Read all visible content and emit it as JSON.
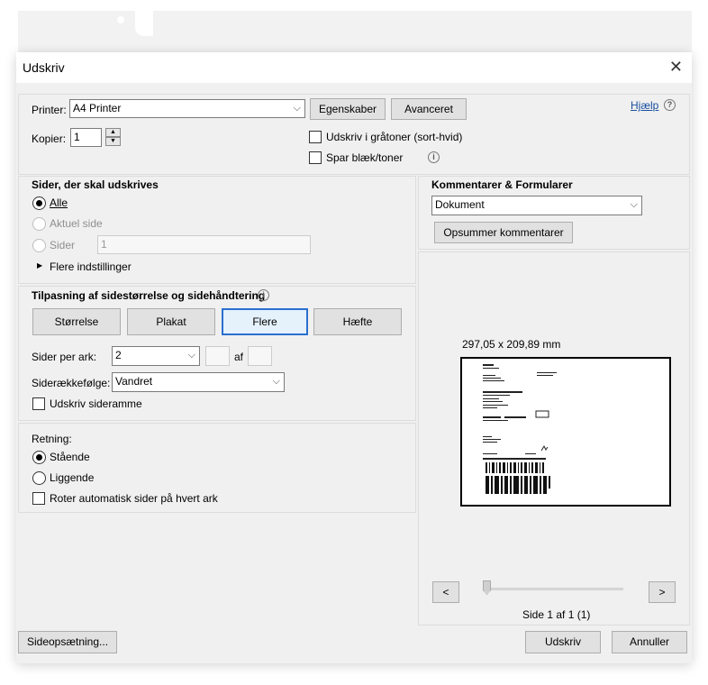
{
  "dialog": {
    "title": "Udskriv"
  },
  "printer": {
    "printer_label": "Printer:",
    "printer_value": "A4 Printer",
    "properties_button": "Egenskaber",
    "advanced_button": "Avanceret",
    "help_link": "Hjælp",
    "copies_label": "Kopier:",
    "copies_value": "1",
    "grayscale_label": "Udskriv i gråtoner (sort-hvid)",
    "grayscale_checked": false,
    "save_ink_label": "Spar blæk/toner",
    "save_ink_checked": false
  },
  "pages": {
    "heading": "Sider, der skal udskrives",
    "all_label": "Alle",
    "current_label": "Aktuel side",
    "pages_label": "Sider",
    "pages_value": "1",
    "more_options": "Flere indstillinger",
    "selected": "Alle"
  },
  "comments": {
    "heading": "Kommentarer & Formularer",
    "dropdown_value": "Dokument",
    "summarize_button": "Opsummer kommentarer"
  },
  "sizing": {
    "heading": "Tilpasning af sidestørrelse og sidehåndtering",
    "tabs": [
      "Størrelse",
      "Plakat",
      "Flere",
      "Hæfte"
    ],
    "active_tab": "Flere",
    "pages_per_sheet_label": "Sider per ark:",
    "pages_per_sheet_value": "2",
    "of_label": "af",
    "page_order_label": "Siderækkefølge:",
    "page_order_value": "Vandret",
    "print_border_label": "Udskriv sideramme",
    "print_border_checked": false
  },
  "orientation": {
    "heading": "Retning:",
    "portrait_label": "Stående",
    "landscape_label": "Liggende",
    "auto_rotate_label": "Roter automatisk sider på hvert ark",
    "selected": "Stående",
    "auto_rotate_checked": false
  },
  "preview": {
    "dimensions": "297,05 x 209,89 mm",
    "prev_button": "<",
    "next_button": ">",
    "page_indicator": "Side 1 af 1 (1)"
  },
  "footer": {
    "page_setup_button": "Sideopsætning...",
    "print_button": "Udskriv",
    "cancel_button": "Annuller"
  },
  "colors": {
    "accent": "#2a6fcf",
    "dialog_bg": "#f0f0f0",
    "link": "#1a4fa0"
  }
}
